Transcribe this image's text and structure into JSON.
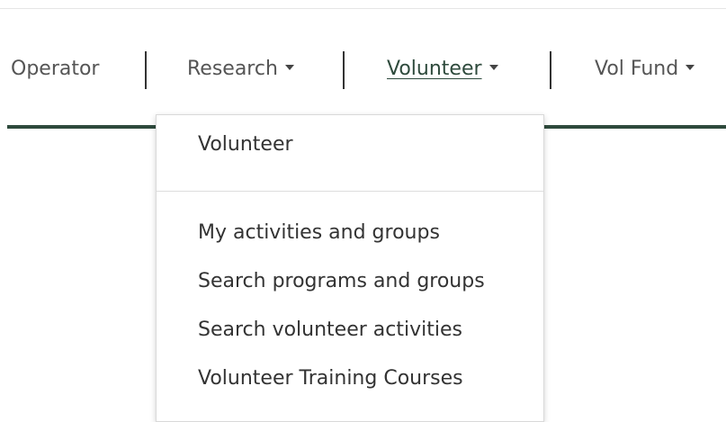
{
  "nav": {
    "items": [
      {
        "label": "Operator",
        "has_dropdown": false,
        "active": false
      },
      {
        "label": "Research",
        "has_dropdown": true,
        "active": false
      },
      {
        "label": "Volunteer",
        "has_dropdown": true,
        "active": true
      },
      {
        "label": "Vol Fund",
        "has_dropdown": true,
        "active": false
      }
    ],
    "accent_color": "#2e4a3c"
  },
  "dropdown": {
    "header": "Volunteer",
    "items": [
      {
        "label": "My activities and groups"
      },
      {
        "label": "Search programs and groups"
      },
      {
        "label": "Search volunteer activities"
      },
      {
        "label": "Volunteer Training Courses"
      }
    ]
  }
}
